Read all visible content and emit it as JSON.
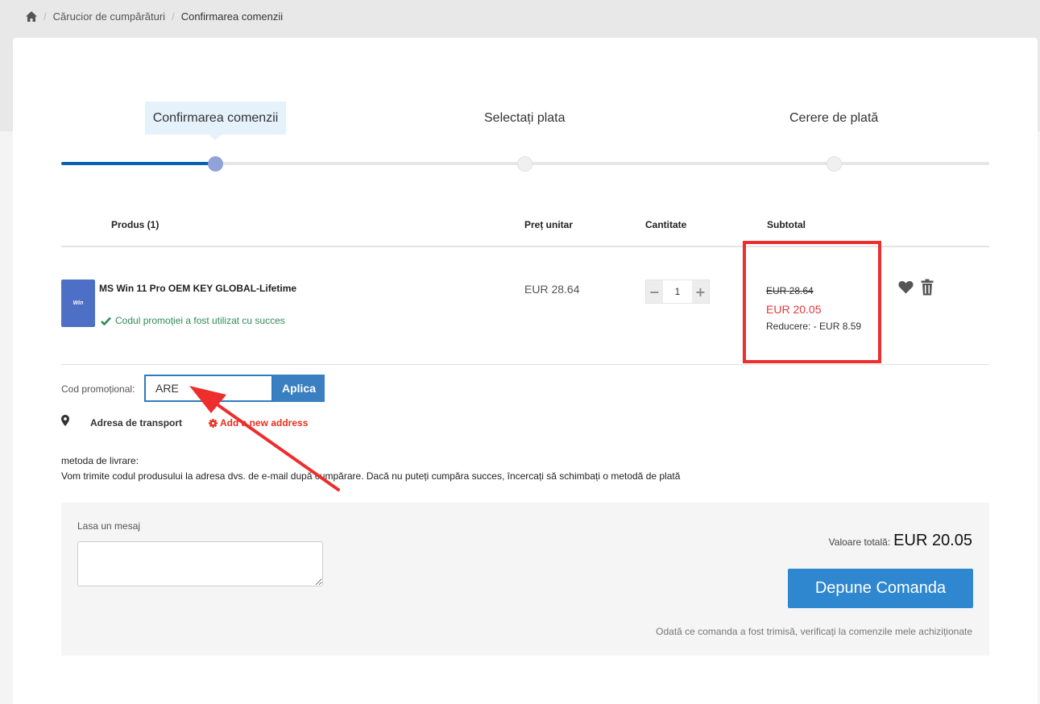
{
  "breadcrumb": {
    "home_icon": "home-icon",
    "items": [
      "Cărucior de cumpărături",
      "Confirmarea comenzii"
    ]
  },
  "steps": [
    {
      "label": "Confirmarea comenzii",
      "active": true
    },
    {
      "label": "Selectați plata",
      "active": false
    },
    {
      "label": "Cerere de plată",
      "active": false
    }
  ],
  "progress": {
    "completed_steps": 1,
    "total_steps": 3
  },
  "table": {
    "headers": {
      "product": "Produs (1)",
      "unit_price": "Preț unitar",
      "quantity": "Cantitate",
      "subtotal": "Subtotal"
    }
  },
  "item": {
    "thumb_text": "Win",
    "name": "MS Win 11 Pro OEM KEY GLOBAL-Lifetime",
    "promo_message": "Codul promoției a fost utilizat cu succes",
    "unit_price": "EUR 28.64",
    "quantity": "1",
    "old_subtotal": "EUR 28.64",
    "new_subtotal": "EUR 20.05",
    "discount": "Reducere: - EUR 8.59"
  },
  "promo": {
    "label": "Cod promoțional:",
    "value": "ARE",
    "apply_label": "Aplica"
  },
  "shipping": {
    "label": "Adresa de transport",
    "add_address": "Add a new address"
  },
  "delivery": {
    "title": "metoda de livrare:",
    "text": "Vom trimite codul produsului la adresa dvs. de e-mail după cumpărare. Dacă nu puteți cumpăra succes, încercați să schimbați o metodă de plată"
  },
  "order": {
    "message_label": "Lasa un mesaj",
    "message_value": "",
    "total_label": "Valoare totală:",
    "total_value": "EUR 20.05",
    "submit_label": "Depune Comanda",
    "note": "Odată ce comanda a fost trimisă, verificați la comenzile mele achiziționate"
  },
  "colors": {
    "accent": "#2e87cf",
    "progress": "#0d5fb0",
    "success": "#2e8b57",
    "discount_price": "#e0393e",
    "annotation": "#ee2d2d"
  }
}
